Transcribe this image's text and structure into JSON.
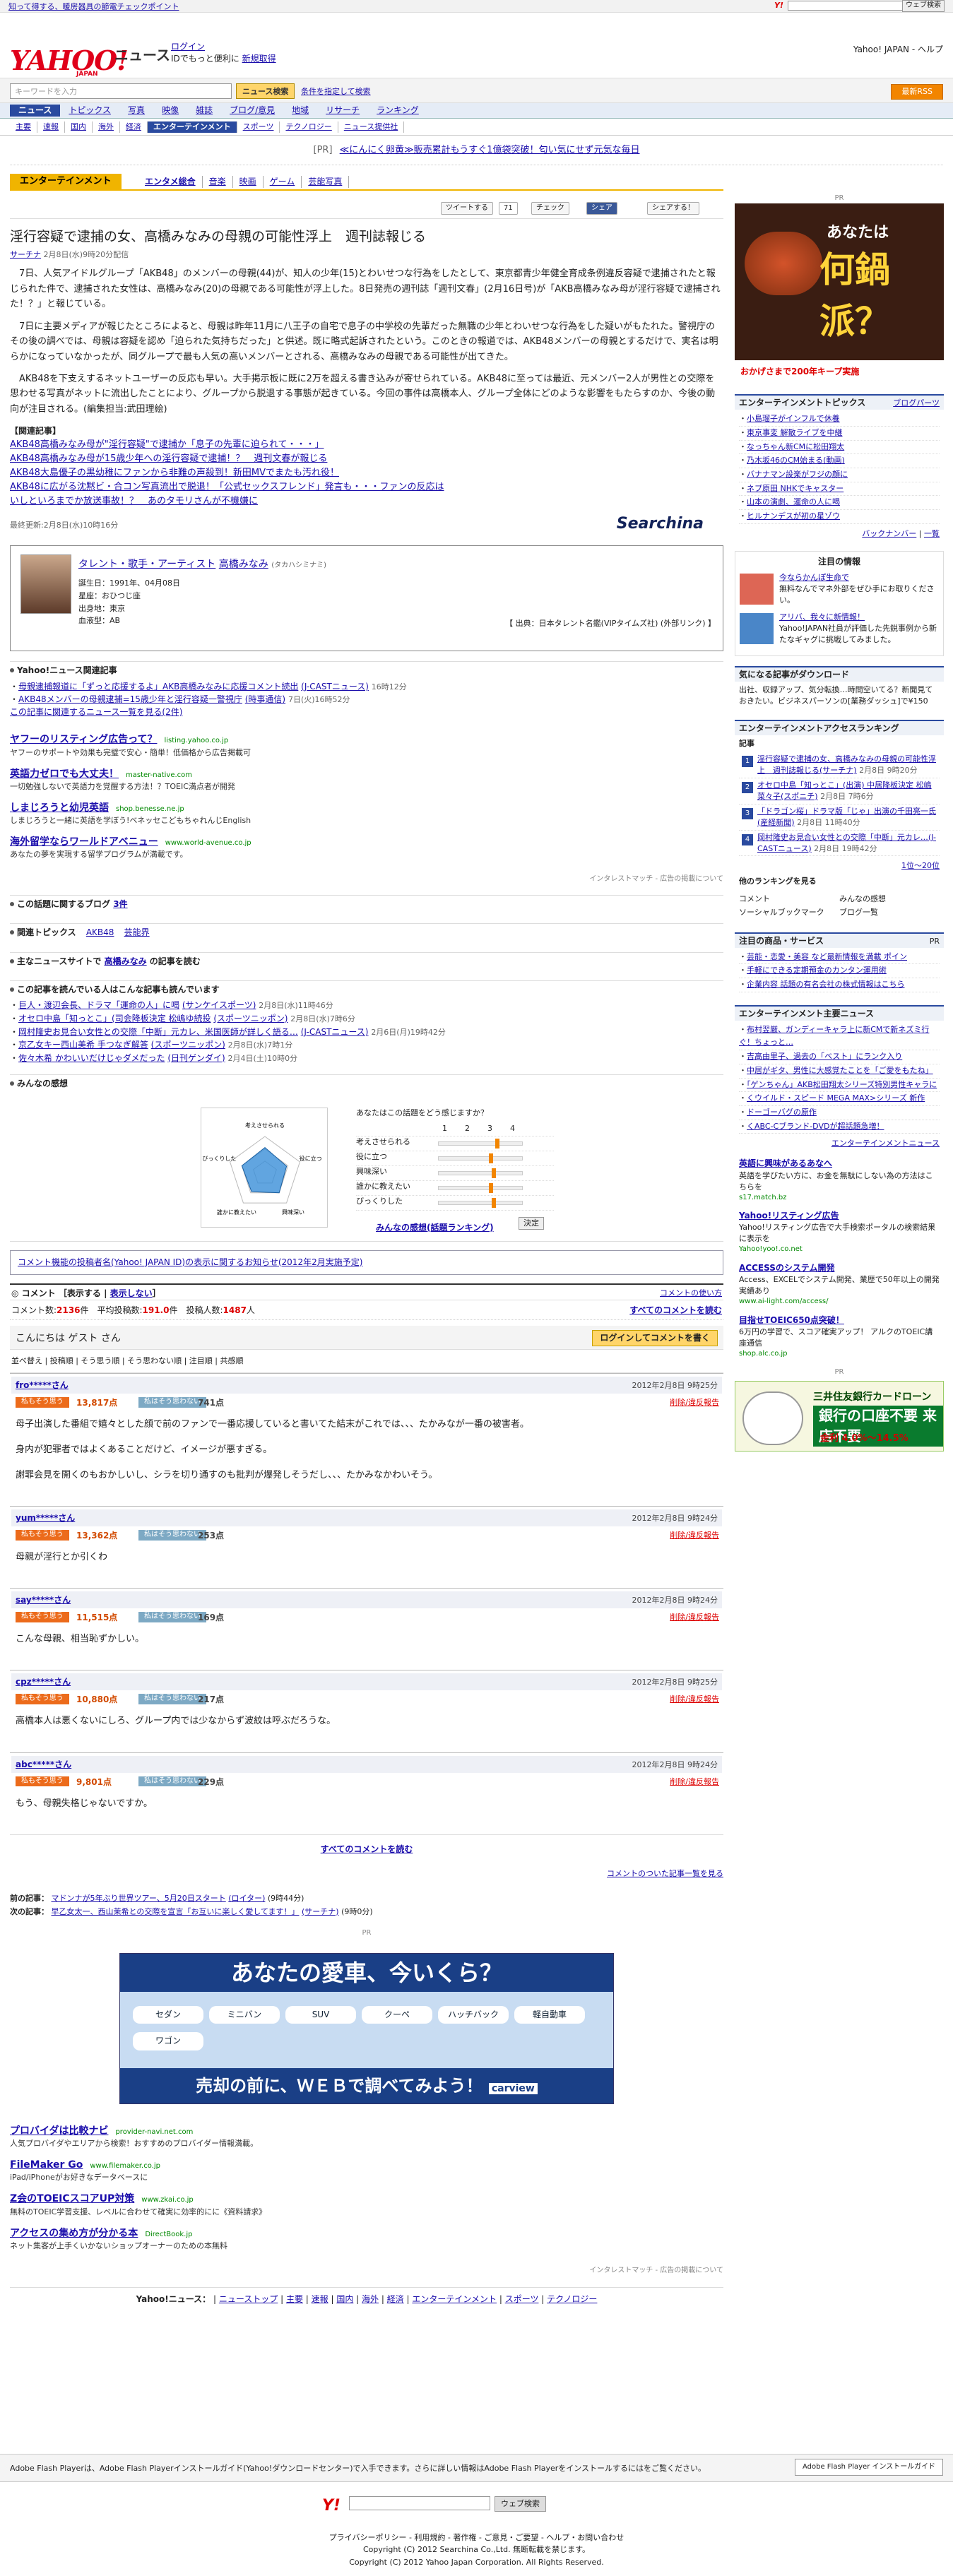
{
  "topstrip": {
    "text": "知って得する、暖房器具の節電チェックポイント",
    "search_button": "ウェブ検索"
  },
  "header": {
    "logo": "YAHOO!",
    "logo_sub": "JAPAN",
    "service": "ニュース",
    "login": "ログイン",
    "login_note": "IDでもっと便利に",
    "signup": "新規取得",
    "right_link": "Yahoo! JAPAN - ヘルプ"
  },
  "search": {
    "placeholder": "キーワードを入力",
    "button": "ニュース検索",
    "cond": "条件を指定して検索",
    "rss": "最新RSS"
  },
  "gnav": [
    "ニュース",
    "トピックス",
    "写真",
    "映像",
    "雑誌",
    "ブログ/意見",
    "地域",
    "リサーチ",
    "ランキング"
  ],
  "subnav": [
    "主要",
    "速報",
    "国内",
    "海外",
    "経済",
    "エンターテインメント",
    "スポーツ",
    "テクノロジー",
    "ニュース提供社"
  ],
  "prbanner": {
    "pr": "[PR]",
    "text": "≪にんにく卵黄≫販売累計もうすぐ1億袋突破！匂い気にせず元気な毎日"
  },
  "category": {
    "name": "エンターテインメント",
    "tabs": [
      "エンタメ総合",
      "音楽",
      "映画",
      "ゲーム",
      "芸能写真"
    ]
  },
  "social": {
    "tweet": "ツイートする",
    "tweet_count": "71",
    "check": "チェック",
    "share": "シェア",
    "mixi": "シェアする！"
  },
  "article": {
    "title": "淫行容疑で逮捕の女、高橋みなみの母親の可能性浮上　週刊誌報じる",
    "source": "サーチナ",
    "date": "2月8日(水)9時20分配信",
    "paragraphs": [
      "7日、人気アイドルグループ「AKB48」のメンバーの母親(44)が、知人の少年(15)とわいせつな行為をしたとして、東京都青少年健全育成条例違反容疑で逮捕されたと報じられた件で、逮捕された女性は、高橋みなみ(20)の母親である可能性が浮上した。8日発売の週刊誌「週刊文春」(2月16日号)が「AKB高橋みなみ母が淫行容疑で逮捕された！？」と報じている。",
      "7日に主要メディアが報じたところによると、母親は昨年11月に八王子の自宅で息子の中学校の先輩だった無職の少年とわいせつな行為をした疑いがもたれた。警視庁のその後の調べでは、母親は容疑を認め「迫られた気持ちだった」と供述。既に略式起訴されたという。このときの報道では、AKB48メンバーの母親とするだけで、実名は明らかになっていなかったが、同グループで最も人気の高いメンバーとされる、高橋みなみの母親である可能性が出てきた。",
      "AKB48を下支えするネットユーザーの反応も早い。大手掲示板に既に2万を超える書き込みが寄せられている。AKB48に至っては最近、元メンバー2人が男性との交際を思わせる写真がネットに流出したことにより、グループから脱退する事態が起きている。今回の事件は高橋本人、グループ全体にどのような影響をもたらすのか、今後の動向が注目される。(編集担当:武田理絵)"
    ],
    "related_title": "【関連記事】",
    "related": [
      "AKB48高橋みなみ母が\"淫行容疑\"で逮捕か「息子の先輩に迫られて・・・」",
      "AKB48高橋みなみ母が15歳少年への淫行容疑で逮捕！？　週刊文春が報じる",
      "AKB48大島優子の黒幼稚にファンから非難の声殺到！新田MVでまたも汚れ役！",
      "AKB48に広がる沈黙ビ・合コン写真流出で脱退！「公式セックスフレンド」発言も・・・ファンの反応は",
      "いしといろまでか放送事故！？　あのタモリさんが不機嫌に"
    ],
    "last_updated": "最終更新:2月8日(水)10時16分",
    "provider_logo": "Searchina"
  },
  "profile": {
    "category": "タレント・歌手・アーティスト",
    "name": "高橋みなみ",
    "kana": "(タカハシミナミ)",
    "rows": [
      "誕生日：1991年、04月08日",
      "星座：おひつじ座",
      "出身地：東京",
      "血液型：AB"
    ],
    "source": "【 出典：日本タレント名鑑(VIPタイムズ社) (外部リンク) 】"
  },
  "related_news": {
    "heading": "Yahoo!ニュース関連記事",
    "items": [
      {
        "t": "母親逮捕報道に「ずっと応援するよ」AKB高橋みなみに応援コメント続出",
        "s": "(J-CASTニュース)",
        "d": "16時12分"
      },
      {
        "t": "AKB48メンバーの母親逮捕=15歳少年と淫行容疑一警視庁",
        "s": "(時事通信)",
        "d": "7日(火)16時52分"
      }
    ],
    "more": "この記事に関連するニュース一覧を見る(2件)"
  },
  "ads": [
    {
      "t": "ヤフーのリスティング広告って？",
      "u": "listing.yahoo.co.jp",
      "d": "ヤフーのサポートや効果も完璧で安心・簡単！低価格から広告掲載可"
    },
    {
      "t": "英語力ゼロでも大丈夫！",
      "u": "master-native.com",
      "d": "一切勉強しないで英語力を覚醒する方法！？TOEIC満点者が開発"
    },
    {
      "t": "しまじろうと幼児英語",
      "u": "shop.benesse.ne.jp",
      "d": "しまじろうと一緒に英語を学ぼう!ベネッセこどもちゃれんじEnglish"
    },
    {
      "t": "海外留学ならワールドアベニュー",
      "u": "www.world-avenue.co.jp",
      "d": "あなたの夢を実現する留学プログラムが満載です。"
    }
  ],
  "admatch": "インタレストマッチ - 広告の掲載について",
  "blog": {
    "label": "この話題に関するブログ",
    "count": "3件"
  },
  "topics": {
    "label": "関連トピックス",
    "items": [
      "AKB48",
      "芸能界"
    ]
  },
  "mainsite": {
    "label": "主なニュースサイトで",
    "name": "高橋みなみ",
    "suffix": "の記事を読む"
  },
  "alsoread": {
    "heading": "この記事を読んでいる人はこんな記事も読んでいます",
    "items": [
      {
        "t": "巨人・渡辺会長、ドラマ「運命の人」に喝",
        "s": "(サンケイスポーツ)",
        "d": "2月8日(水)11時46分"
      },
      {
        "t": "オセロ中島「知っとこ」(司会降板決定 松嶋ゆ続投",
        "s": "(スポーツニッポン)",
        "d": "2月8日(水)7時6分"
      },
      {
        "t": "岡村隆史お見合い女性との交際「中断」元カレ、米国医師が詳しく語る…",
        "s": "(J-CASTニュース)",
        "d": "2月6日(月)19時42分"
      },
      {
        "t": "京乙女キー西山美希 手つなぎ解答",
        "s": "(スポーツニッポン)",
        "d": "2月8日(水)7時1分"
      },
      {
        "t": "佐々木希 かわいいだけじゃダメだった",
        "s": "(日刊ゲンダイ)",
        "d": "2月4日(土)10時0分"
      }
    ]
  },
  "feeling": {
    "heading": "みんなの感想",
    "labels": [
      "考えさせられる",
      "役に立つ",
      "興味深い",
      "誰かに教えたい",
      "びっくりした"
    ],
    "question": "あなたはこの話題をどう感じますか？",
    "scale": [
      "1",
      "2",
      "3",
      "4"
    ],
    "levels": [
      0.7,
      0.62,
      0.66,
      0.62,
      0.66
    ],
    "decide": "決定",
    "rank": "みんなの感想(話題ランキング)"
  },
  "notice": "コメント機能の投稿者名(Yahoo! JAPAN ID)の表示に関するお知らせ(2012年2月実施予定)",
  "comments": {
    "title": "コメント",
    "show": "表示する",
    "hide": "表示しない",
    "usage": "コメントの使い方",
    "stats": "コメント数:",
    "count": "2136",
    "stats2": "件　平均投稿数:",
    "avg": "191.0",
    "stats3": "件　投稿人数:",
    "people": "1487",
    "stats4": "人",
    "readall": "すべてのコメントを読む",
    "guest": "こんにちは ゲスト さん",
    "login_btn": "ログインしてコメントを書く",
    "sort": "並べ替え | 投稿順 | そう思う順 | そう思わない順 | 注目順 | 共感順",
    "items": [
      {
        "u": "fro*****さん",
        "d": "2012年2月8日 9時25分",
        "up": "13,817点",
        "dn": "741点",
        "body": [
          "母子出演した番組で嬉々とした顔で前のファンで一番応援していると書いてた結末がこれでは、、、たかみなが一番の被害者。",
          "身内が犯罪者ではよくあることだけど、イメージが悪すぎる。",
          "謝罪会見を開くのもおかしいし、シラを切り通すのも批判が爆発しそうだし、、、たかみなかわいそう。"
        ]
      },
      {
        "u": "yum*****さん",
        "d": "2012年2月8日 9時24分",
        "up": "13,362点",
        "dn": "253点",
        "body": [
          "母親が淫行とか引くわ"
        ]
      },
      {
        "u": "say*****さん",
        "d": "2012年2月8日 9時24分",
        "up": "11,515点",
        "dn": "169点",
        "body": [
          "こんな母親、相当恥ずかしい。"
        ]
      },
      {
        "u": "cpz*****さん",
        "d": "2012年2月8日 9時25分",
        "up": "10,880点",
        "dn": "217点",
        "body": [
          "高橋本人は悪くないにしろ、グループ内では少なからず波紋は呼ぶだろうな。"
        ]
      },
      {
        "u": "abc*****さん",
        "d": "2012年2月8日 9時24分",
        "up": "9,801点",
        "dn": "229点",
        "body": [
          "もう、母親失格じゃないですか。"
        ]
      }
    ],
    "agree": "私もそう思う",
    "disagree": "私はそう思わない",
    "report": "削除/違反報告",
    "readall2": "すべてのコメントを読む",
    "list": "コメントのついた記事一覧を見る"
  },
  "prevnext": {
    "prev_label": "前の記事：",
    "prev": "マドンナが5年ぶり世界ツアー、5月20日スタート",
    "prev_src": "(ロイター)",
    "prev_date": "(9時44分)",
    "next_label": "次の記事：",
    "next": "早乙女太一、西山茉希との交際を宣言「お互いに楽しく愛してます！」",
    "next_src": "(サーチナ)",
    "next_date": "(9時0分)"
  },
  "carad": {
    "pr": "PR",
    "title": "あなたの愛車、今いくら？",
    "types": [
      "セダン",
      "ミニバン",
      "SUV",
      "クーペ",
      "ハッチバック",
      "軽自動車",
      "ワゴン"
    ],
    "bottom": "売却の前に、ＷＥＢで調べてみよう！",
    "brand": "carview"
  },
  "ads2": [
    {
      "t": "プロバイダは比較ナビ",
      "u": "provider-navi.net.com",
      "d": "人気プロバイダやエリアから検索！おすすめのプロバイダー情報満載。"
    },
    {
      "t": "FileMaker Go",
      "u": "www.filemaker.co.jp",
      "d": "iPad/iPhoneがお好きなデータベースに"
    },
    {
      "t": "Z会のTOEICスコアUP対策",
      "u": "www.zkai.co.jp",
      "d": "無料のTOEIC学習支援、レベルに合わせて確実に効率的にに《資料請求》"
    },
    {
      "t": "アクセスの集め方が分かる本",
      "u": "DirectBook.jp",
      "d": "ネット集客が上手くいかないショップオーナーのための本無料"
    }
  ],
  "footnav": {
    "label": "Yahoo!ニュース：",
    "items": [
      "ニューストップ",
      "主要",
      "速報",
      "国内",
      "海外",
      "経済",
      "エンターテインメント",
      "スポーツ",
      "テクノロジー"
    ]
  },
  "flash": {
    "text": "Adobe Flash Playerは、Adobe Flash Playerインストールガイド(Yahoo!ダウンロードセンター)で入手できます。さらに詳しい情報はAdobe Flash Playerをインストールするにはをご覧ください。",
    "btn": "Adobe Flash Player インストールガイド"
  },
  "footer": {
    "search": "ウェブ検索",
    "links": "プライバシーポリシー - 利用規約 - 著作権 - ご意見・ご要望 - ヘルプ・お問い合わせ",
    "copy1": "Copyright (C) 2012 Searchina Co.,Ltd. 無断転載を禁じます。",
    "copy2": "Copyright (C) 2012 Yahoo Japan Corporation. All Rights Reserved."
  },
  "side": {
    "pr": "PR",
    "nabe1": "あなたは",
    "nabe2": "何鍋派？",
    "nabe_foot": "おかげさまで200年キープ実施",
    "topics_h": "エンターテインメントトピックス",
    "topics_r": "ブログパーツ",
    "topics": [
      "小島瑠子がインフルで休養",
      "東京事変 解散ライブを中継",
      "なっちゃん新CMに松田翔太",
      "乃木坂46のCM始まる(動画)",
      "バナナマン設楽がフジの顔に",
      "ネプ原田 NHKでキャスター",
      "山本の演劇、運命の人に喝",
      "ヒルナンデスが初の星ゾウ"
    ],
    "topics_more": "バックナンバー",
    "topics_more2": "一覧",
    "attn_h": "注目の情報",
    "attn": [
      {
        "t": "今ならかんぽ生命で",
        "d": "無料なんでマネ外部をぜひ手にお取りください。"
      },
      {
        "t": "アリバ、我々に新情報！",
        "d": "Yahoo!JAPAN社員が評価した先鋭事例から新たなギャグに挑戦してみました。"
      }
    ],
    "dl": "気になる記事がダウンロード",
    "dl_d": "出社、収録アップ、気分転換…時間空いてる？新聞見ておきたい。ビジネスパーソンの[業務ダッシュ]で¥150",
    "ranking_h": "エンターテインメントアクセスランキング",
    "ranking_sub": "記事",
    "ranking": [
      {
        "t": "淫行容疑で逮捕の女、高橋みなみの母親の可能性浮上　週刊誌報じる",
        "s": "(サーチナ)",
        "d": "2月8日 9時20分"
      },
      {
        "t": "オセロ中島「知っとこ」(出演) 中居降板決定 松嶋菜々子",
        "s": "(スポニチ)",
        "d": "2月8日 7時6分"
      },
      {
        "t": "「ドラゴン桜」ドラマ版「じゃ」出演の千田亮一氏",
        "s": "(産経新聞)",
        "d": "2月8日 11時40分"
      },
      {
        "t": "岡村隆史お見合い女性との交際「中断」元カレ…",
        "s": "(J-CASTニュース)",
        "d": "2月8日 19時42分"
      }
    ],
    "ranking_more": "1位〜20位",
    "others_h": "他のランキングを見る",
    "others": [
      "コメント",
      "みんなの感想",
      "ソーシャルブックマーク",
      "ブログ一覧"
    ],
    "svc_h": "注目の商品・サービス",
    "svc_pr": "PR",
    "svc": [
      "芸能・恋愛・美容 など最新情報を満載 ポイン",
      "手軽にできる定期預金のカンタン運用術",
      "企業内容 話題の有名会社の株式情報はこちら"
    ],
    "major_h": "エンターテインメント主要ニュース",
    "major": [
      "布村翌厳、ガンディーキャラ上に新CMで新ネズミ行ぐ！ちょっと…",
      "吉高由里子、過去の「ベスト」にランク入り ",
      "中居がギタ、男性に大感覚たことを「ご愛をもたね」",
      "「ゲンちゃん」AKB松田翔太シリーズ特別男性キャラに ",
      "くウイルド・スピード MEGA MAX>シリーズ 新作",
      "ドーゴーバグの原作",
      "くABC-Cブランド-DVDが超話題急増！ "
    ],
    "major_more": "エンターテインメントニュース",
    "sads": [
      {
        "t": "英語に興味があるあなへ",
        "d": "英語を学びたい方に、お金を無駄にしない為の方法はこちらを",
        "u": "s17.match.bz"
      },
      {
        "t": "Yahoo!リスティング広告",
        "d": "Yahoo!リスティング広告で大手検索ポータルの検索結果に表示を",
        "u": "Yahoo!yoo!.co.net"
      },
      {
        "t": "ACCESSのシステム開発",
        "d": "Access、EXCELでシステム開発、業歴で50年以上の開発実績あり",
        "u": "www.ai-light.com/access/"
      },
      {
        "t": "目指せTOEIC650点突破！",
        "d": "6万円の学習で、スコア確実アップ！ アルクのTOEIC講座通信",
        "u": "shop.alc.co.jp"
      }
    ],
    "bank_t": "三井住友銀行カードローン",
    "bank_big": "銀行の口座不要",
    "bank_big2": "来店不要",
    "bank_rate": "金利 4.0%〜14.5%"
  },
  "colors": {
    "brand": "#e0001a",
    "nav": "#2a4a9f",
    "accent": "#f0b400"
  }
}
